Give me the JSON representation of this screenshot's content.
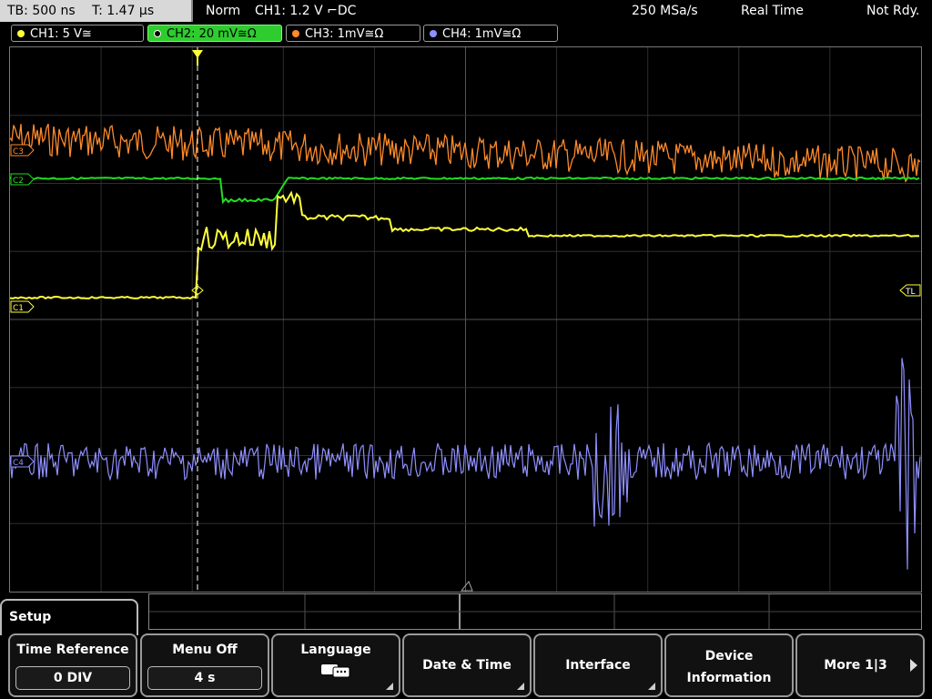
{
  "top": {
    "tb_label": "TB: 500 ns",
    "t_label": "T: 1.47 µs",
    "mode": "Norm",
    "trigger": "CH1: 1.2 V ⌐DC",
    "sample_rate": "250 MSa/s",
    "acq_mode": "Real Time",
    "status": "Not Rdy."
  },
  "channels": [
    {
      "label": "CH1: 5 V≅",
      "color": "#ffff3a"
    },
    {
      "label": "CH2: 20 mV≅Ω",
      "color": "#2ee02e"
    },
    {
      "label": "CH3: 1mV≅Ω",
      "color": "#ff8a2a"
    },
    {
      "label": "CH4: 1mV≅Ω",
      "color": "#8f8fff"
    }
  ],
  "markers": {
    "c3": "C3",
    "c2": "C2",
    "c1": "C1",
    "c4": "C4",
    "trigger_level": "TL"
  },
  "menu": {
    "tab": "Setup",
    "keys": [
      {
        "label": "Time Reference",
        "value": "0 DIV"
      },
      {
        "label": "Menu Off",
        "value": "4 s"
      },
      {
        "label": "Language",
        "icon": "language-icon"
      },
      {
        "label": "Date & Time"
      },
      {
        "label": "Interface"
      },
      {
        "label": "Device Information",
        "line1": "Device",
        "line2": "Information"
      },
      {
        "label": "More 1|3"
      }
    ]
  }
}
